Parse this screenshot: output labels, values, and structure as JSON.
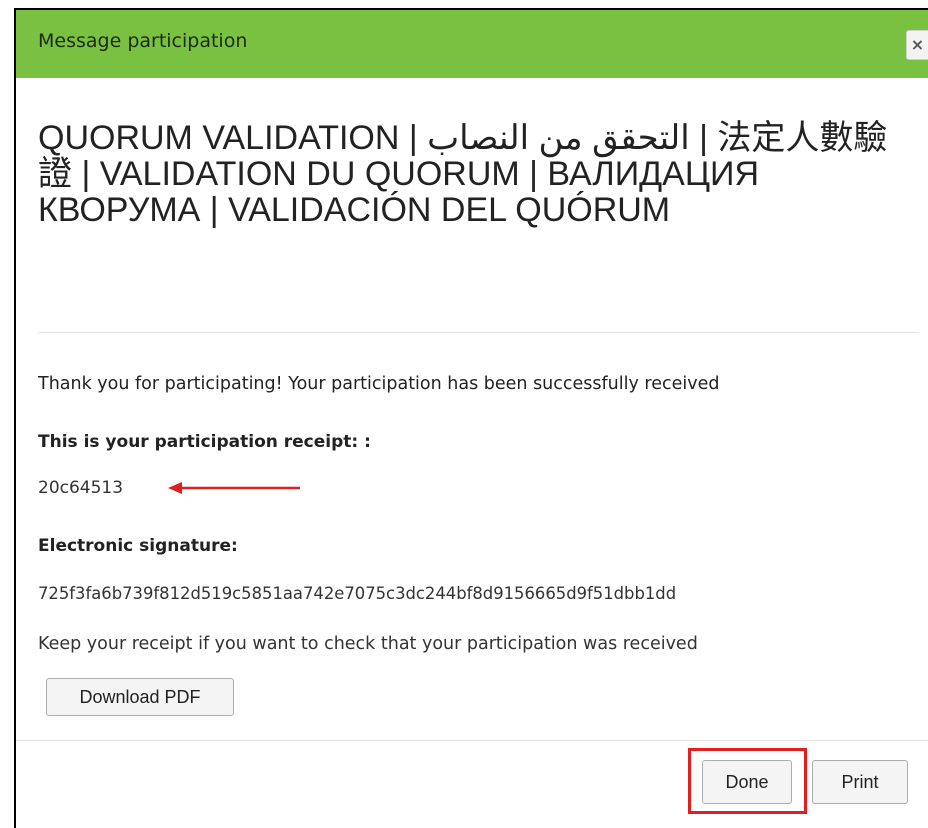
{
  "dialog": {
    "title": "Message participation",
    "close_glyph": "×",
    "close_icon": "close-icon"
  },
  "content": {
    "heading": "QUORUM VALIDATION | التحقق من النصاب | 法定人數驗證 | VALIDATION DU QUORUM | ВАЛИДАЦИЯ КВОРУМА | VALIDACIÓN DEL QUÓRUM",
    "thanks_message": "Thank you for participating! Your participation has been successfully received",
    "receipt_label": "This is your participation receipt: :",
    "receipt_code": "20c64513",
    "signature_label": "Electronic signature:",
    "signature_value": "725f3fa6b739f812d519c5851aa742e7075c3dc244bf8d9156665d9f51dbb1dd",
    "keep_message": "Keep your receipt if you want to check that your participation was received",
    "download_label": "Download PDF"
  },
  "footer": {
    "done_label": "Done",
    "print_label": "Print"
  },
  "annotations": {
    "arrow_color": "#e02020",
    "highlight_color": "#e02020"
  },
  "colors": {
    "titlebar": "#7ac142"
  }
}
